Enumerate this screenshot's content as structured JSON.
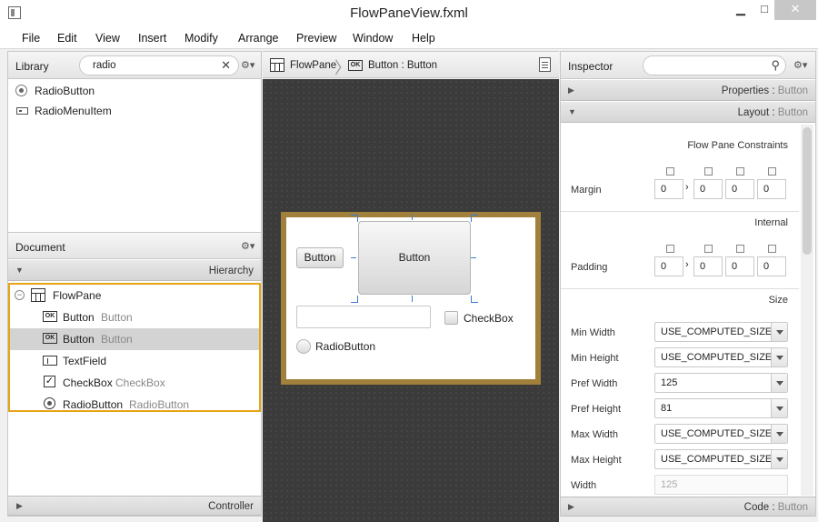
{
  "window": {
    "title": "FlowPaneView.fxml",
    "btn_minimize": "▁",
    "btn_maximize": "□",
    "btn_close": "✕"
  },
  "menu": [
    "File",
    "Edit",
    "View",
    "Insert",
    "Modify",
    "Arrange",
    "Preview",
    "Window",
    "Help"
  ],
  "library": {
    "title": "Library",
    "search_value": "radio",
    "items": [
      "RadioButton",
      "RadioMenuItem"
    ]
  },
  "document": {
    "title": "Document",
    "hierarchy_label": "Hierarchy",
    "controller_label": "Controller",
    "tree": [
      {
        "name": "FlowPane",
        "sub": "",
        "icon": "flowpane-icon"
      },
      {
        "name": "Button",
        "sub": "Button",
        "icon": "button-ok-icon"
      },
      {
        "name": "Button",
        "sub": "Button",
        "icon": "button-ok-icon"
      },
      {
        "name": "TextField",
        "sub": "",
        "icon": "textfield-icon"
      },
      {
        "name": "CheckBox",
        "sub": "CheckBox",
        "icon": "checkbox-icon"
      },
      {
        "name": "RadioButton",
        "sub": "RadioButton",
        "icon": "radiobutton-icon"
      }
    ]
  },
  "breadcrumb": {
    "root": "FlowPane",
    "current": "Button : Button",
    "ok_badge": "OK"
  },
  "canvas": {
    "small_button": "Button",
    "big_button": "Button",
    "checkbox": "CheckBox",
    "radiobutton": "RadioButton"
  },
  "inspector": {
    "title": "Inspector",
    "properties_label": "Properties",
    "properties_type": "Button",
    "layout_label": "Layout",
    "layout_type": "Button",
    "code_label": "Code",
    "code_type": "Button",
    "flowpane_constraints": "Flow Pane Constraints",
    "margin_label": "Margin",
    "margin": [
      "0",
      "0",
      "0",
      "0"
    ],
    "internal": "Internal",
    "padding_label": "Padding",
    "padding": [
      "0",
      "0",
      "0",
      "0"
    ],
    "size": "Size",
    "size_rows": [
      {
        "label": "Min Width",
        "value": "USE_COMPUTED_SIZE"
      },
      {
        "label": "Min Height",
        "value": "USE_COMPUTED_SIZE"
      },
      {
        "label": "Pref Width",
        "value": "125"
      },
      {
        "label": "Pref Height",
        "value": "81"
      },
      {
        "label": "Max Width",
        "value": "USE_COMPUTED_SIZE"
      },
      {
        "label": "Max Height",
        "value": "USE_COMPUTED_SIZE"
      }
    ],
    "width_label": "Width",
    "width_value": "125"
  },
  "colors": {
    "selection_border": "#e8a317",
    "canvas_bg": "#3c3c3c",
    "frame": "#a0803a",
    "handle": "#3a7bd5"
  }
}
